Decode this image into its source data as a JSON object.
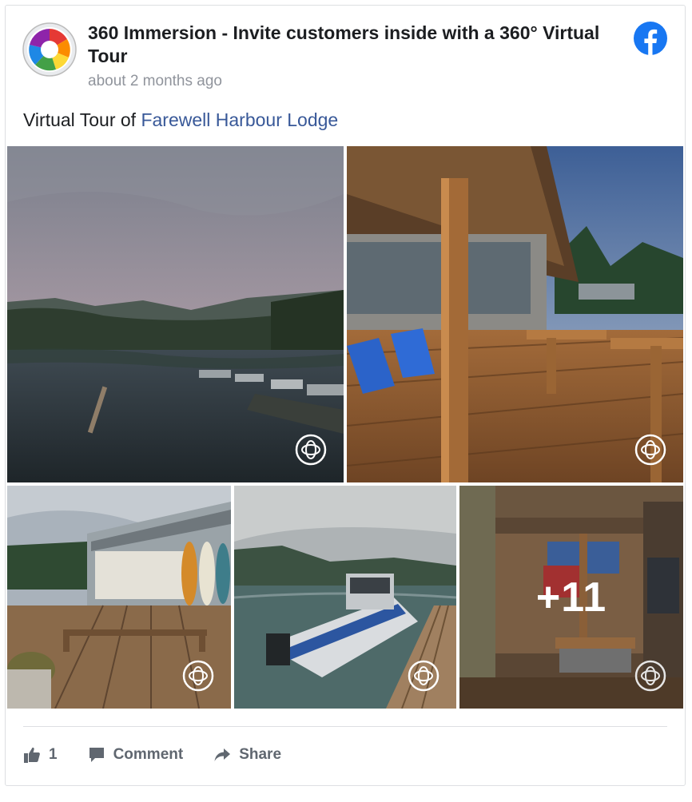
{
  "post": {
    "title": "360 Immersion - Invite customers inside with a 360° Virtual Tour",
    "time": "about 2 months ago",
    "text_prefix": "Virtual Tour of ",
    "text_link": "Farewell Harbour Lodge"
  },
  "gallery": {
    "more_count": "+11"
  },
  "actions": {
    "like_count": "1",
    "comment_label": "Comment",
    "share_label": "Share"
  },
  "colors": {
    "link": "#385898",
    "facebook_blue": "#1877f2",
    "action_gray": "#606770"
  },
  "icons": [
    "avatar-logo",
    "facebook-icon",
    "360-icon",
    "like-icon",
    "comment-icon",
    "share-icon"
  ]
}
